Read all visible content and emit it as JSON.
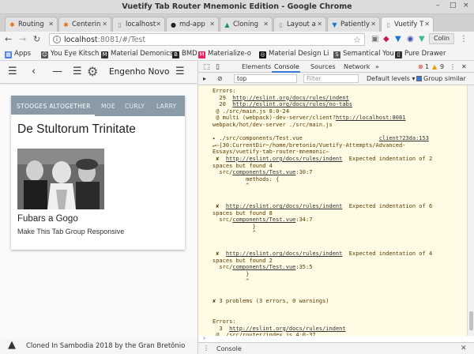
{
  "window": {
    "title": "Vuetify Tab Router Mnemonic Edition - Google Chrome",
    "controls": [
      "–",
      "□",
      "×"
    ]
  },
  "tabs": [
    {
      "label": "Routing",
      "icon": "asterisk-icon",
      "color": "#e8710a"
    },
    {
      "label": "Centerin",
      "icon": "asterisk-icon",
      "color": "#e8710a"
    },
    {
      "label": "localhost",
      "icon": "page-icon",
      "color": "#888888"
    },
    {
      "label": "md-app",
      "icon": "github-icon",
      "color": "#222222"
    },
    {
      "label": "Cloning",
      "icon": "triangle-icon",
      "color": "#1a8f7a"
    },
    {
      "label": "Layout a",
      "icon": "page-icon",
      "color": "#888888"
    },
    {
      "label": "Patiently",
      "icon": "vuetify-icon",
      "color": "#1976d2"
    },
    {
      "label": "Vuetify T",
      "icon": "page-icon",
      "color": "#888888",
      "active": true
    }
  ],
  "toolbar": {
    "url_host": "localhost",
    "url_path": ":8081/#/Test",
    "profile": "Colin"
  },
  "bookmarks": [
    {
      "label": "Apps",
      "color": "#4a7ee0"
    },
    {
      "label": "You Eye Kitsch",
      "color": "#555555"
    },
    {
      "label": "Material Demonics",
      "color": "#333333"
    },
    {
      "label": "BMD",
      "color": "#222222"
    },
    {
      "label": "Materialize-o",
      "color": "#e91e63"
    },
    {
      "label": "Material Design Li",
      "color": "#111111"
    },
    {
      "label": "Semantical You",
      "color": "#555555"
    },
    {
      "label": "Pure Drawer",
      "color": "#333333"
    }
  ],
  "app": {
    "title": "Engenho Novo ...",
    "tabs": [
      "STOOGES ALTOGETHER",
      "MOE",
      "CURLY",
      "LARRY"
    ],
    "active_tab": 0,
    "heading": "De Stultorum Trinitate",
    "subtitle": "Fubars a Gogo",
    "caption": "Make This Tab Group Responsive",
    "footer": "Cloned In Sambodia 2018 by the Gran Bretônio"
  },
  "devtools": {
    "tabs": [
      "Elements",
      "Console",
      "Sources",
      "Network"
    ],
    "active_tab": 1,
    "error_count": "1",
    "warning_count": "9",
    "context": "top",
    "filter_placeholder": "Filter",
    "levels": "Default levels ▾",
    "group_similar": "Group similar",
    "drawer_tab": "Console"
  },
  "console_lines": [
    {
      "text": "Errors:",
      "link": ""
    },
    {
      "text": "  29  ",
      "link": "http://eslint.org/docs/rules/indent"
    },
    {
      "text": "  20  ",
      "link": "http://eslint.org/docs/rules/no-tabs"
    },
    {
      "text": " @ ./src/main.js 8:0-24",
      "link": ""
    },
    {
      "text": " @ multi (webpack)-dev-server/client?",
      "link": "http://localhost:8081"
    },
    {
      "text": "webpack/hot/dev-server ./src/main.js",
      "link": ""
    },
    {
      "text": "",
      "link": ""
    },
    {
      "text": "▸ ./src/components/Test.vue                       ",
      "link": "client?23da:153"
    },
    {
      "text": "↵⇦[30:CurrentDir~/home/bretonio/Vuetify-Attempts/Advanced-",
      "link": ""
    },
    {
      "text": "Essays/vuetify-tab-router-mnemonic⇦",
      "link": ""
    },
    {
      "text": " ✘  ",
      "link": "http://eslint.org/docs/rules/indent",
      "after": "  Expected indentation of 2"
    },
    {
      "text": "spaces but found 4",
      "link": ""
    },
    {
      "text": "  src/",
      "link": "components/Test.vue",
      "after": ":30:7"
    },
    {
      "text": "          methods: {",
      "link": ""
    },
    {
      "text": "          ^",
      "link": ""
    },
    {
      "text": "",
      "link": ""
    },
    {
      "text": "",
      "link": ""
    },
    {
      "text": " ✘  ",
      "link": "http://eslint.org/docs/rules/indent",
      "after": "  Expected indentation of 6"
    },
    {
      "text": "spaces but found 8",
      "link": ""
    },
    {
      "text": "  src/",
      "link": "components/Test.vue",
      "after": ":34:7"
    },
    {
      "text": "            }",
      "link": ""
    },
    {
      "text": "            ^",
      "link": ""
    },
    {
      "text": "",
      "link": ""
    },
    {
      "text": "",
      "link": ""
    },
    {
      "text": " ✘  ",
      "link": "http://eslint.org/docs/rules/indent",
      "after": "  Expected indentation of 4"
    },
    {
      "text": "spaces but found 2",
      "link": ""
    },
    {
      "text": "  src/",
      "link": "components/Test.vue",
      "after": ":35:5"
    },
    {
      "text": "          }",
      "link": ""
    },
    {
      "text": "          ^",
      "link": ""
    },
    {
      "text": "",
      "link": ""
    },
    {
      "text": "",
      "link": ""
    },
    {
      "text": "✘ 3 problems (3 errors, 0 warnings)",
      "link": ""
    },
    {
      "text": "",
      "link": ""
    },
    {
      "text": "",
      "link": ""
    },
    {
      "text": "Errors:",
      "link": ""
    },
    {
      "text": "  3  ",
      "link": "http://eslint.org/docs/rules/indent"
    },
    {
      "text": " @ ./src/router/index.js 4:0-37",
      "link": ""
    },
    {
      "text": " @ ./src/main.js",
      "link": ""
    },
    {
      "text": " @ multi (webpack)-dev-server/client?",
      "link": "http://localhost:8081"
    },
    {
      "text": "webpack/hot/dev-server ./src/main.js",
      "link": ""
    }
  ]
}
